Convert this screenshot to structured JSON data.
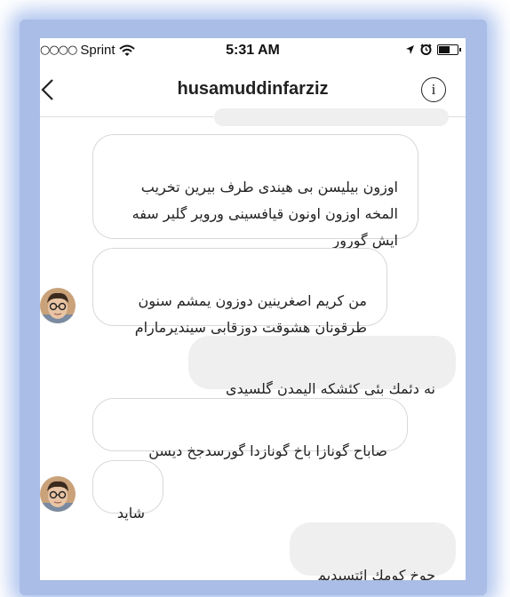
{
  "status_bar": {
    "signal": "○○○○",
    "carrier": "Sprint",
    "time": "5:31 AM"
  },
  "header": {
    "title": "husamuddinfarziz",
    "info_glyph": "i"
  },
  "messages": [
    {
      "direction": "incoming",
      "text": "اوزون بیلیسن بی هیندی طرف بیرین تخریب\nالمخه اوزون اونون قیافسینی ورویر گلیر سفه\nایش گورور"
    },
    {
      "direction": "incoming",
      "text": "من کریم اصغرینین دوزون یمشم سنون\nطرقونان هشوقت دوزقابی سیندیرمارام"
    },
    {
      "direction": "outgoing",
      "text": "نه دئمك بئی کئشکه الیمدن گلسیدی"
    },
    {
      "direction": "incoming",
      "text": "صاباح گونازا باخ گونازدا گورسدجخ دیسن"
    },
    {
      "direction": "incoming",
      "text": "شاید"
    },
    {
      "direction": "outgoing",
      "text": "چوخ کومك ائتسیدیم"
    }
  ],
  "colors": {
    "frame_glow": "#a9bde6",
    "incoming_bubble": "#ffffff",
    "outgoing_bubble": "#efefef",
    "border": "#d8d8d8"
  }
}
